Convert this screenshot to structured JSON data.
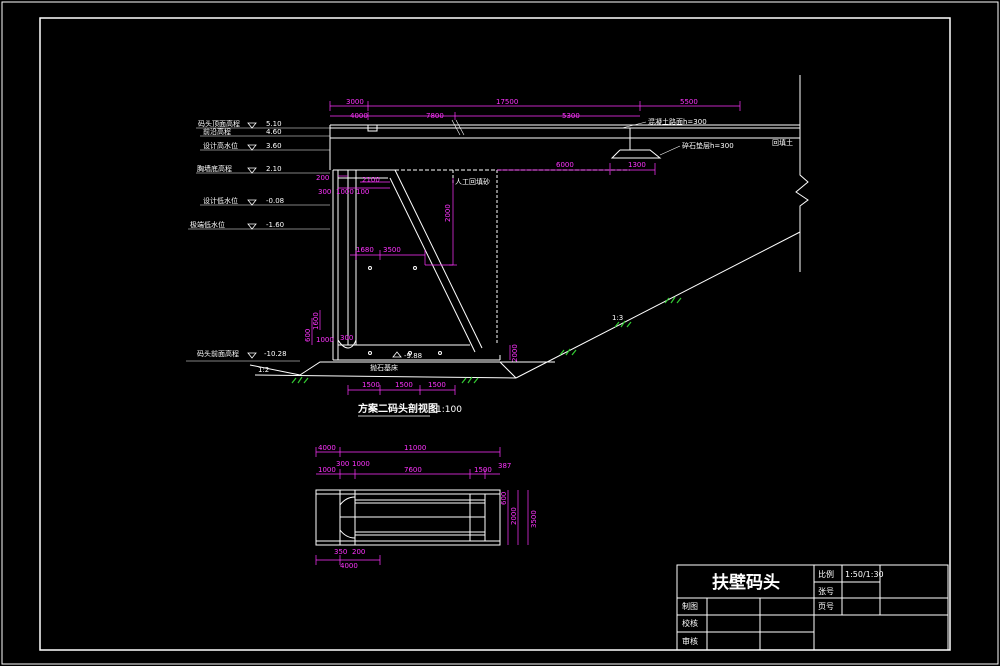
{
  "elevations": [
    {
      "label": "码头顶面高程",
      "value": "5.10"
    },
    {
      "label": "前沿高程",
      "value": "4.60"
    },
    {
      "label": "设计高水位",
      "value": "3.60"
    },
    {
      "label": "胸墙底高程",
      "value": "2.10"
    },
    {
      "label": "设计低水位",
      "value": "-0.08"
    },
    {
      "label": "极端低水位",
      "value": "-1.60"
    },
    {
      "label": "码头前面高程",
      "value": "-10.28"
    }
  ],
  "section": {
    "title": "方案二码头剖视图",
    "scale": "1:100",
    "dims": {
      "top_3000": "3000",
      "top_17500": "17500",
      "top_5500": "5500",
      "second_4000": "4000",
      "second_7800": "7800",
      "second_5300": "5300",
      "d_200": "200",
      "d_2100": "2100",
      "d_300": "300",
      "d_1000": "1000",
      "d_100": "100",
      "d_6000": "6000",
      "d_1300": "1300",
      "d_2000": "2000",
      "d_1680": "1680",
      "d_3500": "3500",
      "d_600_left": "600",
      "d_1000_low": "1000",
      "d_300_low": "300",
      "d_1500a": "1500",
      "d_1500b": "1500",
      "d_1500c": "1500",
      "d_1600": "1600",
      "d_2000_right": "2000"
    },
    "notes": {
      "concrete": "混凝土路面h=300",
      "gravel": "碎石垫层h=300",
      "fill": "回填土",
      "backfill": "人工回填砂",
      "bed": "抛石基床",
      "bottom_elev": "-9.88",
      "slope_left": "1:2",
      "slope_right": "1:3"
    }
  },
  "plan": {
    "dims": {
      "top_4000": "4000",
      "top_11000": "11000",
      "d_1000": "1000",
      "d_300": "300",
      "d_1000b": "1000",
      "d_7600": "7600",
      "d_1500": "1500",
      "d_387": "387",
      "right_3500": "3500",
      "right_2000": "2000",
      "right_600": "600",
      "bottom_350": "350",
      "bottom_200": "200",
      "bottom_4000": "4000"
    }
  },
  "title_block": {
    "drawing_title": "扶壁码头",
    "scale_label": "比例",
    "scale_value": "1:50/1:30",
    "sheet_label": "张号",
    "page_label": "页号",
    "drawn_label": "制图",
    "checked_label": "校核",
    "reviewed_label": "审核"
  },
  "colors": {
    "background": "#000000",
    "line": "#ffffff",
    "dimension": "#ff33ff",
    "grass": "#33cc33"
  }
}
